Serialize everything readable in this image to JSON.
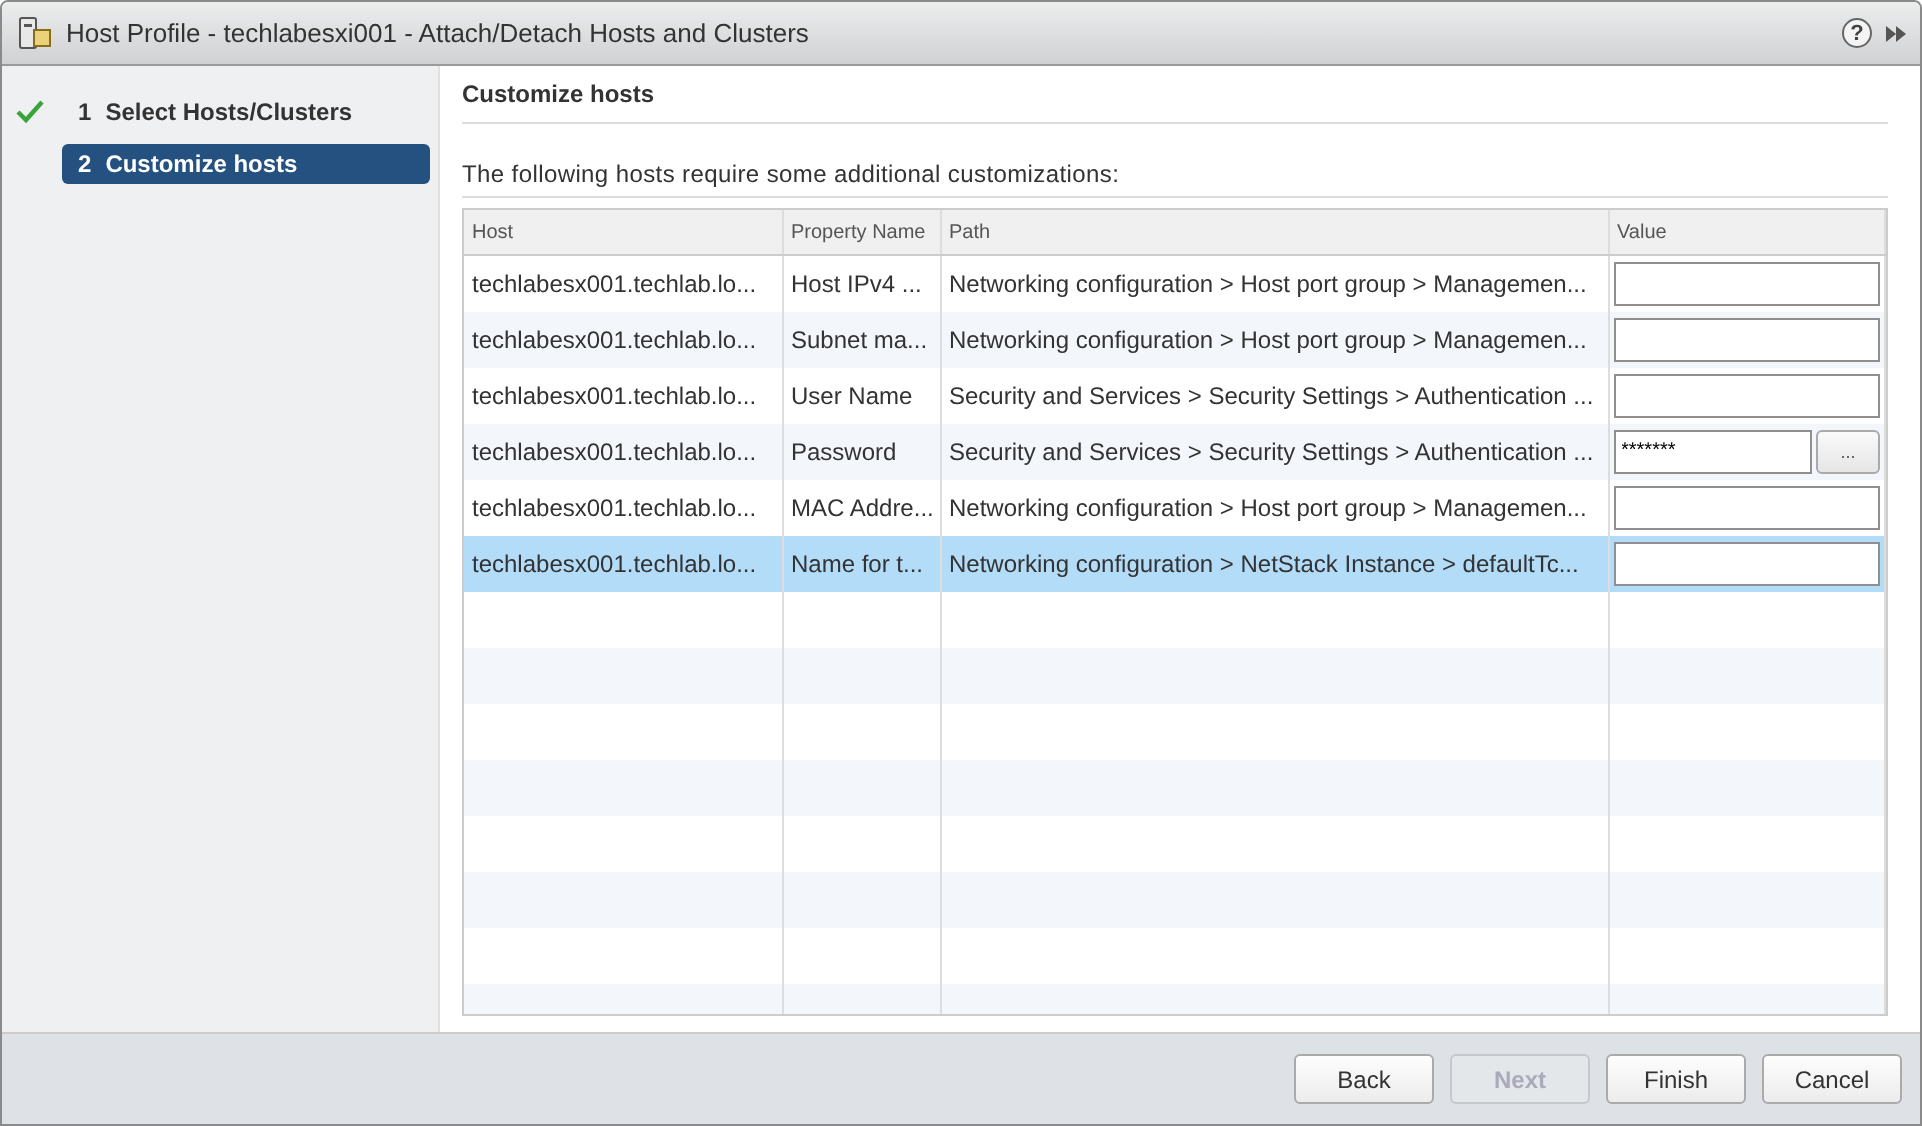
{
  "window": {
    "title": "Host Profile - techlabesxi001 - Attach/Detach Hosts and Clusters",
    "help": "?"
  },
  "steps": [
    {
      "number": "1",
      "label": "Select Hosts/Clusters",
      "done": true,
      "selected": false
    },
    {
      "number": "2",
      "label": "Customize hosts",
      "done": false,
      "selected": true
    }
  ],
  "page": {
    "heading": "Customize hosts",
    "description": "The following hosts require some additional customizations:"
  },
  "table": {
    "columns": [
      "Host",
      "Property Name",
      "Path",
      "Value"
    ],
    "rows": [
      {
        "host": "techlabesx001.techlab.lo...",
        "property": "Host IPv4 ...",
        "path": "Networking configuration > Host port group > Managemen...",
        "value": {
          "kind": "text"
        },
        "selected": false
      },
      {
        "host": "techlabesx001.techlab.lo...",
        "property": "Subnet ma...",
        "path": "Networking configuration > Host port group > Managemen...",
        "value": {
          "kind": "text"
        },
        "selected": false
      },
      {
        "host": "techlabesx001.techlab.lo...",
        "property": "User Name",
        "path": "Security and Services > Security Settings > Authentication ...",
        "value": {
          "kind": "text"
        },
        "selected": false
      },
      {
        "host": "techlabesx001.techlab.lo...",
        "property": "Password",
        "path": "Security and Services > Security Settings > Authentication ...",
        "value": {
          "kind": "password",
          "text": "*******",
          "button": "..."
        },
        "selected": false
      },
      {
        "host": "techlabesx001.techlab.lo...",
        "property": "MAC Addre...",
        "path": "Networking configuration > Host port group > Managemen...",
        "value": {
          "kind": "text"
        },
        "selected": false
      },
      {
        "host": "techlabesx001.techlab.lo...",
        "property": "Name for t...",
        "path": "Networking configuration > NetStack Instance > defaultTc...",
        "value": {
          "kind": "text"
        },
        "selected": true
      }
    ]
  },
  "buttons": [
    {
      "label": "Back",
      "disabled": false
    },
    {
      "label": "Next",
      "disabled": true
    },
    {
      "label": "Finish",
      "disabled": false
    },
    {
      "label": "Cancel",
      "disabled": false
    }
  ]
}
